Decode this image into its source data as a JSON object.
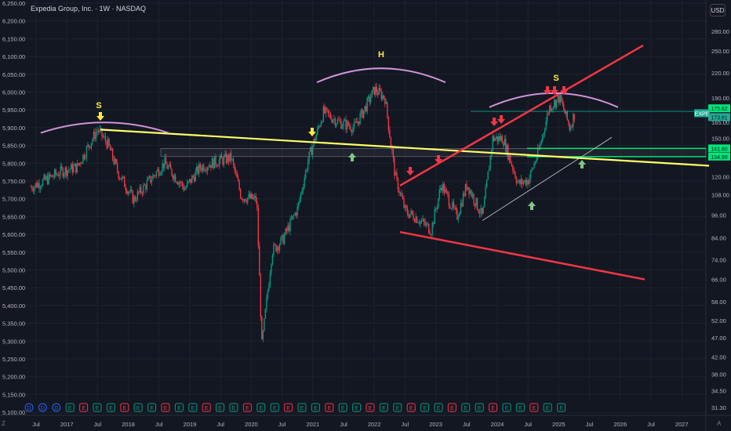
{
  "header": {
    "title": "Expedia Group, Inc. · 1W · NASDAQ",
    "currency_button": "USD",
    "corner_left": "Z",
    "corner_right": "A"
  },
  "chart_data": {
    "type": "candlestick",
    "symbol": "EXPE",
    "interval": "1W",
    "exchange": "NASDAQ",
    "y_scale": "log",
    "left_axis_ticks": [
      "6,250.00",
      "6,200.00",
      "6,150.00",
      "6,100.00",
      "6,050.00",
      "6,000.00",
      "5,950.00",
      "5,900.00",
      "5,850.00",
      "5,800.00",
      "5,750.00",
      "5,700.00",
      "5,650.00",
      "5,600.00",
      "5,550.00",
      "5,500.00",
      "5,450.00",
      "5,400.00",
      "5,350.00",
      "5,300.00",
      "5,250.00",
      "5,200.00",
      "5,150.00",
      "5,100.00"
    ],
    "right_axis_ticks": [
      280.0,
      250.0,
      220.0,
      190.0,
      165.0,
      150.0,
      120.0,
      108.0,
      96.0,
      84.0,
      74.0,
      66.0,
      58.0,
      52.0,
      47.0,
      42.0,
      38.0,
      34.5,
      31.3
    ],
    "x_ticks": [
      "Jul",
      "2017",
      "Jul",
      "2018",
      "Jul",
      "2019",
      "Jul",
      "2020",
      "Jul",
      "2021",
      "Jul",
      "2022",
      "Jul",
      "2023",
      "Jul",
      "2024",
      "Jul",
      "2025",
      "Jul",
      "2026",
      "Jul",
      "2027"
    ],
    "price_labels": [
      {
        "text": "175.62",
        "value": 175.62,
        "color": "#22ab94"
      },
      {
        "text": "EXPE",
        "value": 173.81,
        "color": "#22ab94"
      },
      {
        "text": "173.81",
        "value": 173.81,
        "color": "#22ab94"
      },
      {
        "text": "141.60",
        "value": 141.6,
        "color": "#00e676"
      },
      {
        "text": "134.99",
        "value": 134.99,
        "color": "#00e676"
      }
    ],
    "weekly_closes": [
      {
        "date": "2016-06",
        "close": 113
      },
      {
        "date": "2016-09",
        "close": 118
      },
      {
        "date": "2016-12",
        "close": 124
      },
      {
        "date": "2017-03",
        "close": 127
      },
      {
        "date": "2017-06",
        "close": 150
      },
      {
        "date": "2017-07",
        "close": 158
      },
      {
        "date": "2017-09",
        "close": 145
      },
      {
        "date": "2017-11",
        "close": 123
      },
      {
        "date": "2018-02",
        "close": 105
      },
      {
        "date": "2018-05",
        "close": 117
      },
      {
        "date": "2018-08",
        "close": 130
      },
      {
        "date": "2018-12",
        "close": 112
      },
      {
        "date": "2019-03",
        "close": 127
      },
      {
        "date": "2019-06",
        "close": 131
      },
      {
        "date": "2019-09",
        "close": 134
      },
      {
        "date": "2019-11",
        "close": 107
      },
      {
        "date": "2020-02",
        "close": 105
      },
      {
        "date": "2020-03",
        "close": 45
      },
      {
        "date": "2020-05",
        "close": 78
      },
      {
        "date": "2020-07",
        "close": 83
      },
      {
        "date": "2020-10",
        "close": 100
      },
      {
        "date": "2020-12",
        "close": 132
      },
      {
        "date": "2021-03",
        "close": 175
      },
      {
        "date": "2021-06",
        "close": 165
      },
      {
        "date": "2021-09",
        "close": 160
      },
      {
        "date": "2021-11",
        "close": 178
      },
      {
        "date": "2022-01",
        "close": 200
      },
      {
        "date": "2022-03",
        "close": 190
      },
      {
        "date": "2022-05",
        "close": 120
      },
      {
        "date": "2022-07",
        "close": 98
      },
      {
        "date": "2022-09",
        "close": 95
      },
      {
        "date": "2022-12",
        "close": 88
      },
      {
        "date": "2023-02",
        "close": 115
      },
      {
        "date": "2023-05",
        "close": 95
      },
      {
        "date": "2023-07",
        "close": 115
      },
      {
        "date": "2023-10",
        "close": 95
      },
      {
        "date": "2023-12",
        "close": 150
      },
      {
        "date": "2024-02",
        "close": 150
      },
      {
        "date": "2024-05",
        "close": 115
      },
      {
        "date": "2024-07",
        "close": 118
      },
      {
        "date": "2024-09",
        "close": 140
      },
      {
        "date": "2024-11",
        "close": 180
      },
      {
        "date": "2025-01",
        "close": 190
      },
      {
        "date": "2025-02",
        "close": 175
      },
      {
        "date": "2025-03",
        "close": 160
      },
      {
        "date": "2025-04",
        "close": 174
      }
    ],
    "annotations": {
      "pattern_labels": [
        "S",
        "H",
        "S"
      ],
      "label_color": "#ffeb3b",
      "arc_color": "#ce93d8",
      "neckline_color": "#ffff66",
      "channel_color": "#f23645",
      "support_color": "#00e676",
      "up_arrow_color": "#81c784",
      "down_arrow_color": "#f23645",
      "yellow_arrow_color": "#ffeb3b"
    },
    "event_markers": [
      "D",
      "D",
      "D",
      "E",
      "E",
      "E",
      "E",
      "E",
      "E",
      "E",
      "E",
      "E",
      "E",
      "E",
      "E",
      "E",
      "E",
      "E",
      "E",
      "E",
      "E",
      "E",
      "E",
      "E",
      "E",
      "E",
      "E",
      "E",
      "E",
      "E",
      "E",
      "E",
      "E",
      "E",
      "E",
      "E",
      "E",
      "E",
      "E",
      "E"
    ],
    "colors": {
      "up": "#089981",
      "down": "#f23645",
      "background": "#131722",
      "grid": "#1e222d",
      "axis_text": "#b2b5be"
    }
  }
}
